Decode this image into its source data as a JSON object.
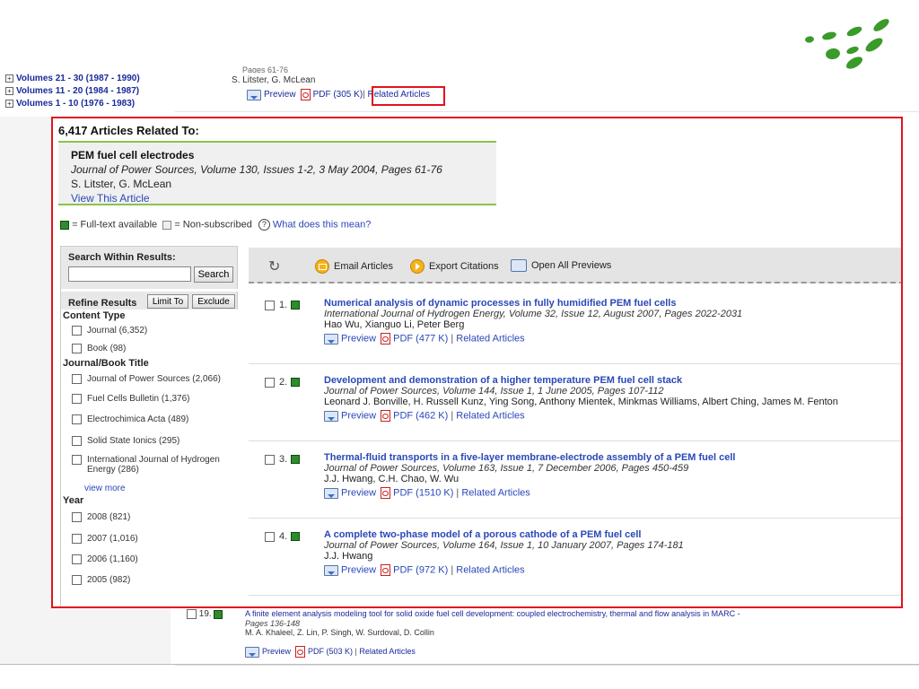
{
  "background": {
    "volumes": [
      "Volumes 21 - 30 (1987 - 1990)",
      "Volumes 11 - 20 (1984 - 1987)",
      "Volumes 1 - 10 (1976 - 1983)"
    ],
    "top_article": {
      "pages": "Pages 61-76",
      "authors": "S. Litster, G. McLean",
      "preview": "Preview",
      "pdf": "PDF (305 K)",
      "related": "Related Articles"
    },
    "row19": {
      "number": "19.",
      "title": "A finite element analysis modeling tool for solid oxide fuel cell development: coupled electrochemistry, thermal and flow analysis in MARC -",
      "pages": "Pages 136-148",
      "authors": "M. A. Khaleel, Z. Lin, P. Singh, W. Surdoval, D. Collin",
      "preview": "Preview",
      "pdf": "PDF (503 K)",
      "related": "Related Articles"
    }
  },
  "popup": {
    "heading": "6,417 Articles Related To:",
    "original": {
      "title": "PEM fuel cell electrodes",
      "journal": "Journal of Power Sources, Volume 130, Issues 1-2, 3 May 2004, Pages 61-76",
      "authors": "S. Litster, G. McLean",
      "view_link": "View This Article"
    },
    "legend": {
      "fulltext": "= Full-text available",
      "nonsub": "= Non-subscribed",
      "help_link": "What does this mean?"
    },
    "sidebar": {
      "search_heading": "Search Within Results:",
      "search_value": "",
      "search_button": "Search",
      "refine_heading": "Refine Results",
      "limit_button": "Limit To",
      "exclude_button": "Exclude",
      "content_type_heading": "Content Type",
      "content_types": [
        "Journal (6,352)",
        "Book (98)"
      ],
      "title_heading": "Journal/Book Title",
      "titles": [
        "Journal of Power Sources (2,066)",
        "Fuel Cells Bulletin (1,376)",
        "Electrochimica Acta (489)",
        "Solid State Ionics (295)",
        "International Journal of Hydrogen Energy (286)"
      ],
      "view_more": "view more",
      "year_heading": "Year",
      "years": [
        "2008 (821)",
        "2007 (1,016)",
        "2006 (1,160)",
        "2005 (982)"
      ]
    },
    "toolbar": {
      "email": "Email Articles",
      "export": "Export Citations",
      "previews": "Open All Previews"
    },
    "results": [
      {
        "number": "1.",
        "title": "Numerical analysis of dynamic processes in fully humidified PEM fuel cells",
        "journal": "International Journal of Hydrogen Energy, Volume 32, Issue 12, August 2007, Pages 2022-2031",
        "authors": "Hao Wu, Xianguo Li, Peter Berg",
        "preview": "Preview",
        "pdf": "PDF (477 K)",
        "related": "Related Articles"
      },
      {
        "number": "2.",
        "title": "Development and demonstration of a higher temperature PEM fuel cell stack",
        "journal": "Journal of Power Sources, Volume 144, Issue 1, 1 June 2005, Pages 107-112",
        "authors": "Leonard J. Bonville, H. Russell Kunz, Ying Song, Anthony Mientek, Minkmas Williams, Albert Ching, James M. Fenton",
        "preview": "Preview",
        "pdf": "PDF (462 K)",
        "related": "Related Articles"
      },
      {
        "number": "3.",
        "title": "Thermal-fluid transports in a five-layer membrane-electrode assembly of a PEM fuel cell",
        "journal": "Journal of Power Sources, Volume 163, Issue 1, 7 December 2006, Pages 450-459",
        "authors": "J.J. Hwang, C.H. Chao, W. Wu",
        "preview": "Preview",
        "pdf": "PDF (1510 K)",
        "related": "Related Articles"
      },
      {
        "number": "4.",
        "title": "A complete two-phase model of a porous cathode of a PEM fuel cell",
        "journal": "Journal of Power Sources, Volume 164, Issue 1, 10 January 2007, Pages 174-181",
        "authors": "J.J. Hwang",
        "preview": "Preview",
        "pdf": "PDF (972 K)",
        "related": "Related Articles"
      }
    ]
  },
  "colors": {
    "highlight": "#e0141e",
    "link": "#2a48b8",
    "fulltext": "#2e8b2e",
    "logo": "#3a9a2a"
  },
  "icons": [
    "refresh-icon",
    "email-icon",
    "export-icon",
    "previews-icon",
    "preview-icon",
    "pdf-icon",
    "help-icon",
    "logo"
  ]
}
